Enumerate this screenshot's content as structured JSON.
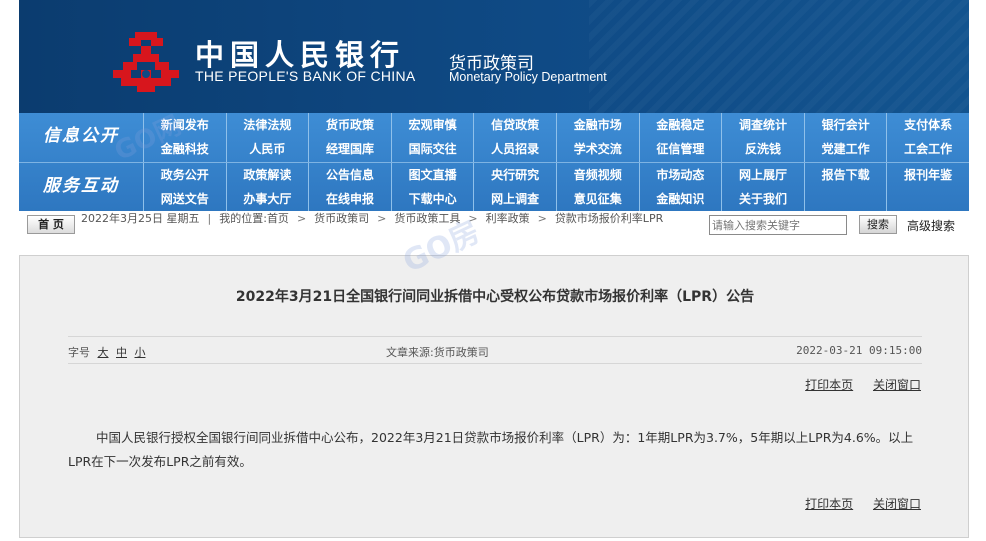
{
  "header": {
    "cn_name": "中国人民银行",
    "en_name": "THE PEOPLE'S BANK OF CHINA",
    "dept_cn": "货币政策司",
    "dept_en": "Monetary Policy Department",
    "colors": {
      "background": "#0f4a85",
      "logo": "#d7161d"
    }
  },
  "nav": {
    "groups": [
      {
        "title": "信息公开",
        "items": [
          "新闻发布",
          "法律法规",
          "货币政策",
          "宏观审慎",
          "信贷政策",
          "金融市场",
          "金融稳定",
          "调查统计",
          "银行会计",
          "支付体系",
          "金融科技",
          "人民币",
          "经理国库",
          "国际交往",
          "人员招录",
          "学术交流",
          "征信管理",
          "反洗钱",
          "党建工作",
          "工会工作"
        ]
      },
      {
        "title": "服务互动",
        "items": [
          "政务公开",
          "政策解读",
          "公告信息",
          "图文直播",
          "央行研究",
          "音频视频",
          "市场动态",
          "网上展厅",
          "报告下载",
          "报刊年鉴",
          "网送文告",
          "办事大厅",
          "在线申报",
          "下载中心",
          "网上调查",
          "意见征集",
          "金融知识",
          "关于我们",
          "",
          ""
        ]
      }
    ],
    "colors": {
      "bar": "#3a88d0"
    }
  },
  "location": {
    "home_label": "首 页",
    "date": "2022年3月25日 星期五",
    "label": "我的位置:",
    "crumbs": [
      "首页",
      "货币政策司",
      "货币政策工具",
      "利率政策",
      "贷款市场报价利率LPR"
    ],
    "separator": ">",
    "search_placeholder": "请输入搜索关键字",
    "search_label": "搜索",
    "advanced_label": "高级搜索"
  },
  "article": {
    "title": "2022年3月21日全国银行间同业拆借中心受权公布贷款市场报价利率（LPR）公告",
    "font_size_label": "字号",
    "font_sizes": [
      "大",
      "中",
      "小"
    ],
    "source_label": "文章来源:",
    "source": "货币政策司",
    "datetime": "2022-03-21 09:15:00",
    "print_label": "打印本页",
    "close_label": "关闭窗口",
    "body": "中国人民银行授权全国银行间同业拆借中心公布，2022年3月21日贷款市场报价利率（LPR）为：1年期LPR为3.7%，5年期以上LPR为4.6%。以上LPR在下一次发布LPR之前有效。"
  },
  "watermarks": [
    "GO网",
    "GO房"
  ]
}
